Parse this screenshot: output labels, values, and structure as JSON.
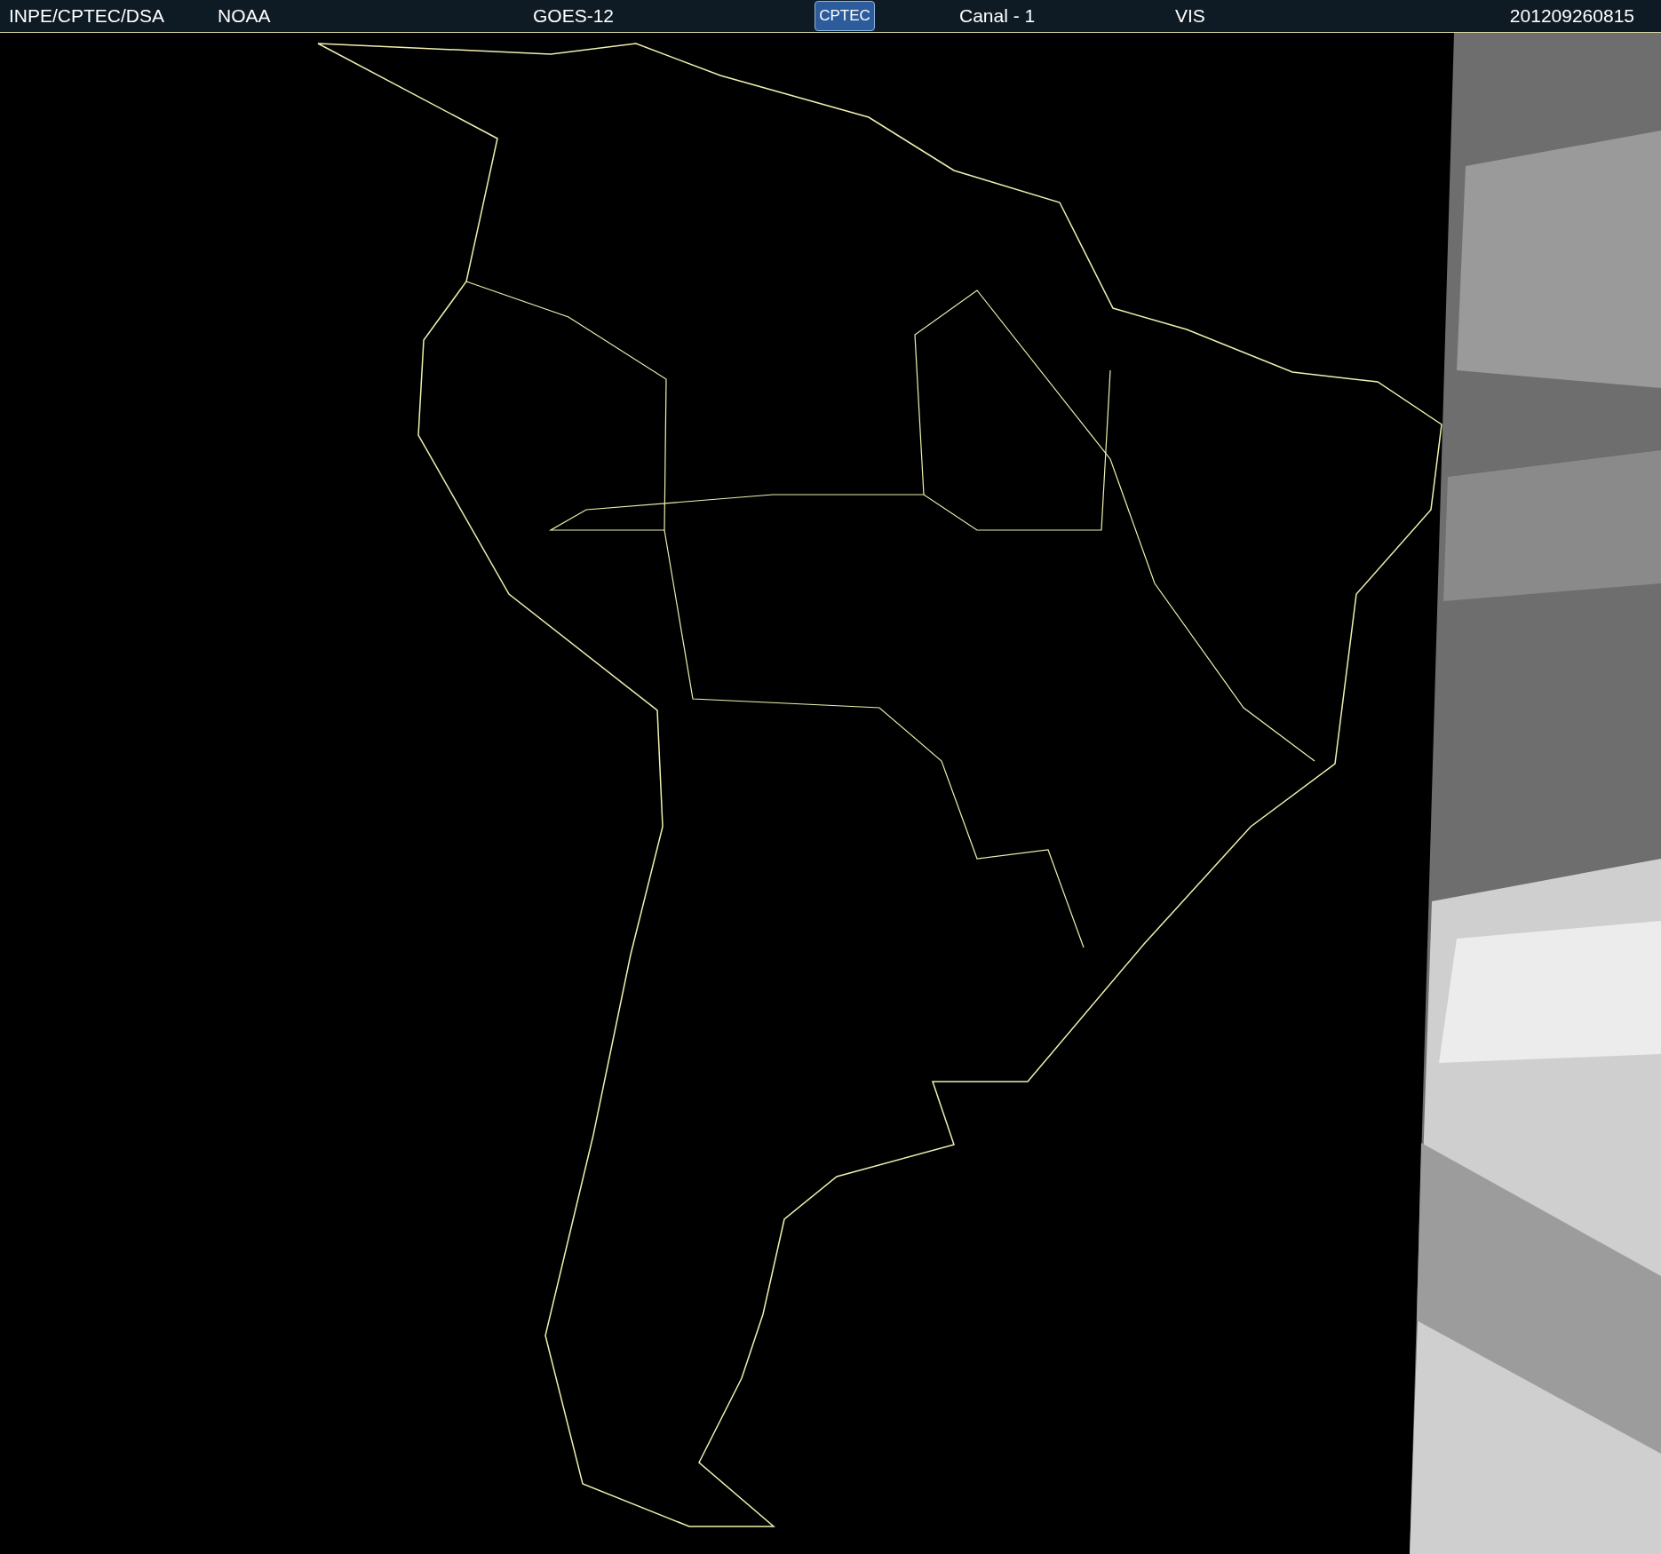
{
  "header": {
    "items": [
      {
        "kind": "text",
        "text": "INPE/CPTEC/DSA"
      },
      {
        "kind": "text",
        "text": "NOAA"
      },
      {
        "kind": "text",
        "text": "GOES-12"
      },
      {
        "kind": "logo",
        "text": "CPTEC"
      },
      {
        "kind": "text",
        "text": "Canal - 1"
      },
      {
        "kind": "text",
        "text": "VIS"
      },
      {
        "kind": "text",
        "text": "201209260815"
      }
    ]
  }
}
